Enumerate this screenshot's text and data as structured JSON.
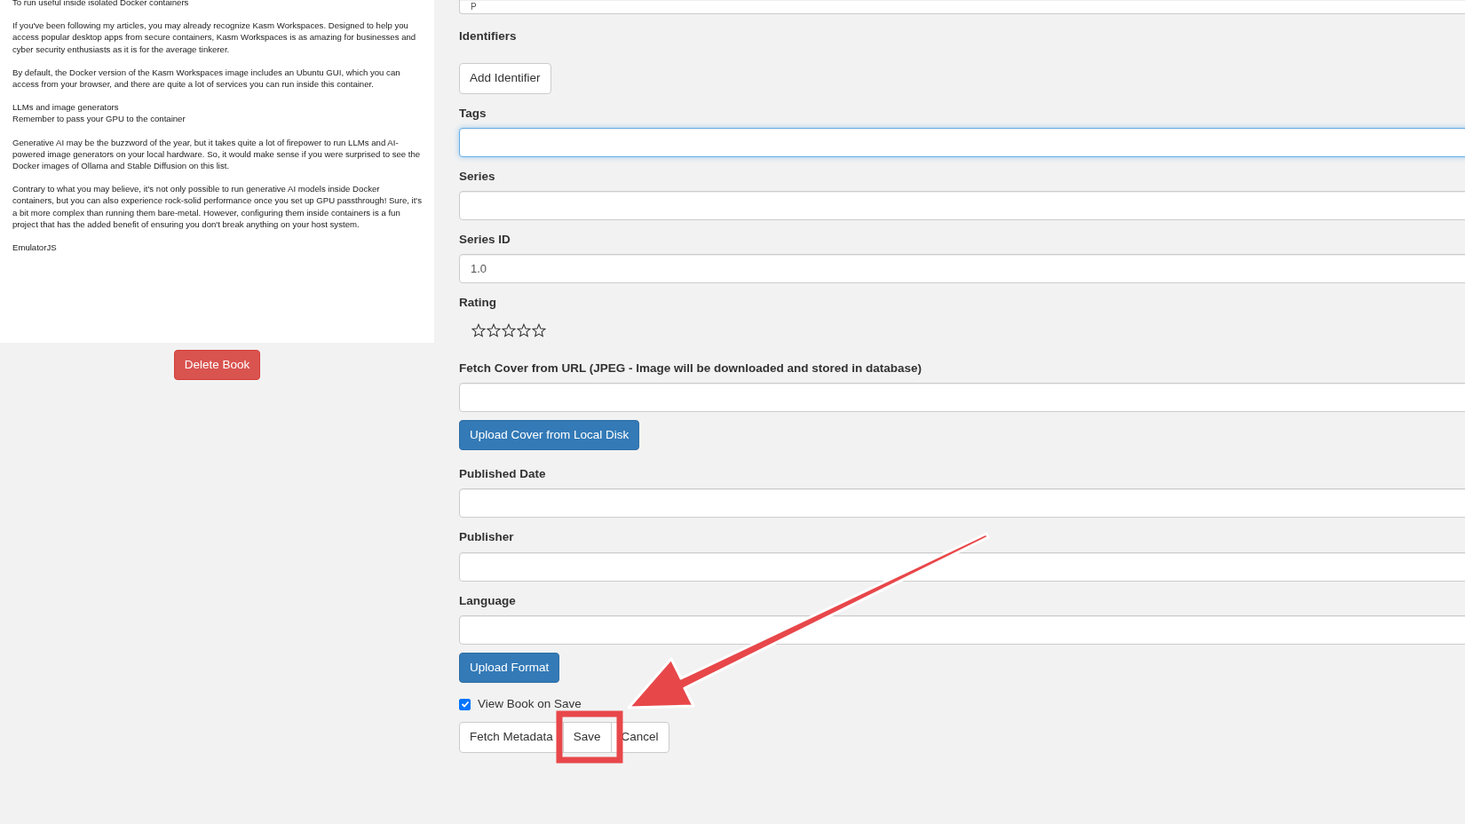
{
  "description": {
    "paragraphs": [
      "To run useful inside isolated Docker containers",
      "If you've been following my articles, you may already recognize Kasm Workspaces. Designed to help you access popular desktop apps from secure containers, Kasm Workspaces is as amazing for businesses and cyber security enthusiasts as it is for the average tinkerer.",
      "By default, the Docker version of the Kasm Workspaces image includes an Ubuntu GUI, which you can access from your browser, and there are quite a lot of services you can run inside this container.",
      "LLMs and image generators\nRemember to pass your GPU to the container",
      "Generative AI may be the buzzword of the year, but it takes quite a lot of firepower to run LLMs and AI-powered image generators on your local hardware. So, it would make sense if you were surprised to see the Docker images of Ollama and Stable Diffusion on this list.",
      "Contrary to what you may believe, it's not only possible to run generative AI models inside Docker containers, but you can also experience rock-solid performance once you set up GPU passthrough! Sure, it's a bit more complex than running them bare-metal. However, configuring them inside containers is a fun project that has the added benefit of ensuring you don't break anything on your host system.",
      "EmulatorJS"
    ]
  },
  "delete_button": "Delete Book",
  "form": [
    {
      "kind": "partial-field",
      "value": "P"
    },
    {
      "kind": "button",
      "label": "Identifiers",
      "button": "Add Identifier"
    },
    {
      "kind": "field",
      "label": "Tags",
      "focused": true
    },
    {
      "kind": "field",
      "label": "Series",
      "focused": false
    },
    {
      "kind": "field",
      "label": "Series ID",
      "value": "1.0",
      "focused": false
    },
    {
      "kind": "rating",
      "label": "Rating",
      "stars": 0
    },
    {
      "kind": "field",
      "label": "Fetch Cover from URL (JPEG - Image will be downloaded and stored in database)",
      "focused": false
    },
    {
      "kind": "primary-button",
      "button": "Upload Cover from Local Disk"
    },
    {
      "kind": "field",
      "label": "Published Date",
      "focused": false
    },
    {
      "kind": "field",
      "label": "Publisher",
      "focused": false
    },
    {
      "kind": "field",
      "label": "Language",
      "focused": false
    },
    {
      "kind": "primary-button",
      "button": "Upload Format"
    },
    {
      "kind": "checkbox",
      "label": "View Book on Save",
      "checked": true
    }
  ],
  "actions": [
    "Fetch Metadata",
    "Save",
    "Cancel"
  ]
}
